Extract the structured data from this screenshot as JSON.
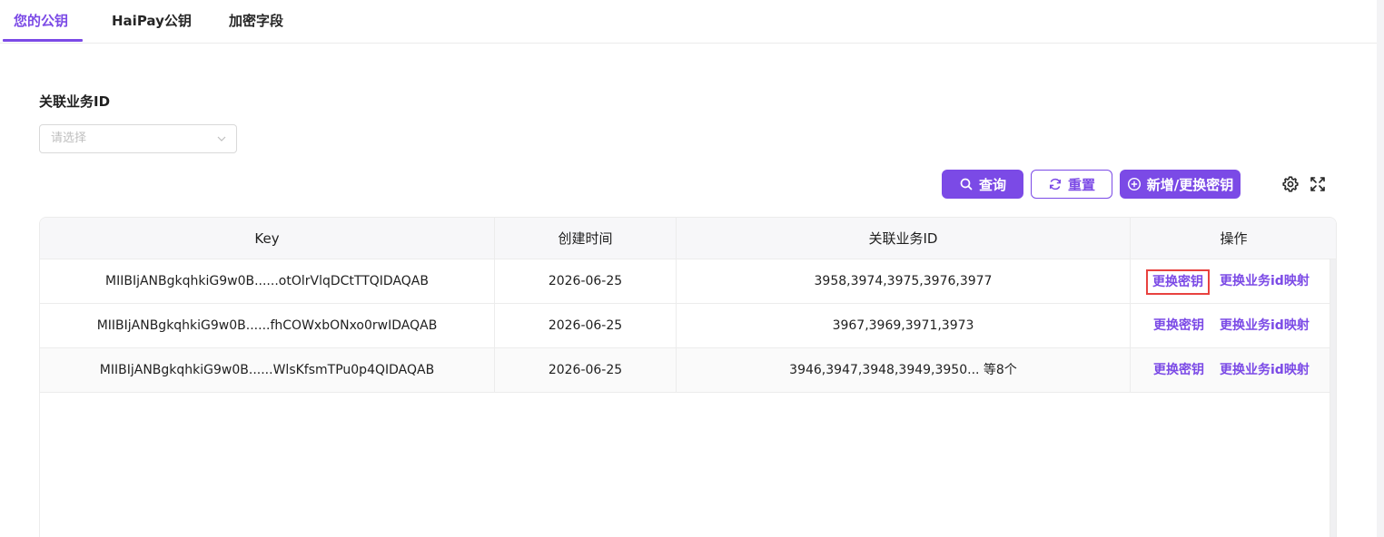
{
  "tabs": [
    {
      "label": "您的公钥",
      "active": true
    },
    {
      "label": "HaiPay公钥",
      "active": false
    },
    {
      "label": "加密字段",
      "active": false
    }
  ],
  "filter": {
    "label": "关联业务ID",
    "placeholder": "请选择"
  },
  "toolbar": {
    "query_label": "查询",
    "reset_label": "重置",
    "add_label": "新增/更换密钥",
    "settings_icon": "gear-icon",
    "fullscreen_icon": "fullscreen-icon"
  },
  "table": {
    "columns": [
      "Key",
      "创建时间",
      "关联业务ID",
      "操作"
    ],
    "rows": [
      {
        "key": "MIIBIjANBgkqhkiG9w0B......otOlrVlqDCtTTQIDAQAB",
        "created": "2026-06-25",
        "biz_ids": "3958,3974,3975,3976,3977",
        "action1": "更换密钥",
        "action2": "更换业务id映射"
      },
      {
        "key": "MIIBIjANBgkqhkiG9w0B......fhCOWxbONxo0rwIDAQAB",
        "created": "2026-06-25",
        "biz_ids": "3967,3969,3971,3973",
        "action1": "更换密钥",
        "action2": "更换业务id映射"
      },
      {
        "key": "MIIBIjANBgkqhkiG9w0B......WlsKfsmTPu0p4QIDAQAB",
        "created": "2026-06-25",
        "biz_ids": "3946,3947,3948,3949,3950... 等8个",
        "action1": "更换密钥",
        "action2": "更换业务id映射"
      }
    ]
  },
  "colors": {
    "accent": "#7b4ae6",
    "highlight": "#e8423f"
  }
}
